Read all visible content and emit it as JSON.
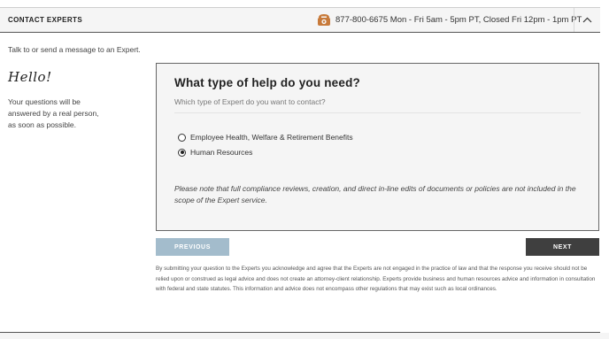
{
  "header": {
    "title": "CONTACT EXPERTS",
    "phone_icon": "phone-icon",
    "phone_text": "877-800-6675  Mon - Fri 5am - 5pm PT,  Closed Fri 12pm - 1pm PT",
    "collapse_icon": "chevron-up-icon"
  },
  "intro": "Talk to or send a message to an Expert.",
  "sidebar": {
    "greeting": "Hello!",
    "note": "Your questions will be answered by a real person, as soon as possible."
  },
  "panel": {
    "title": "What type of help do you need?",
    "subtitle": "Which type of Expert do you want to contact?",
    "options": [
      {
        "label": "Employee Health, Welfare & Retirement Benefits",
        "checked": false
      },
      {
        "label": "Human Resources",
        "checked": true
      }
    ],
    "note": "Please note that full compliance reviews, creation, and direct in-line edits of documents or policies are not included in the scope of the Expert service."
  },
  "buttons": {
    "previous": "PREVIOUS",
    "next": "NEXT"
  },
  "disclaimer": "By submitting your question to the Experts you acknowledge and agree that the Experts are not engaged in the practice of law and that the response you receive should not be relied upon or construed as legal advice and does not create an attorney-client relationship. Experts provide business and human resources advice and information in consultation with federal and state statutes. This information and advice does not encompass other regulations that may exist such as local ordinances.",
  "colors": {
    "previous_button": "#a3bccc",
    "next_button": "#3f3f3f",
    "phone_icon": "#c87a3a"
  }
}
